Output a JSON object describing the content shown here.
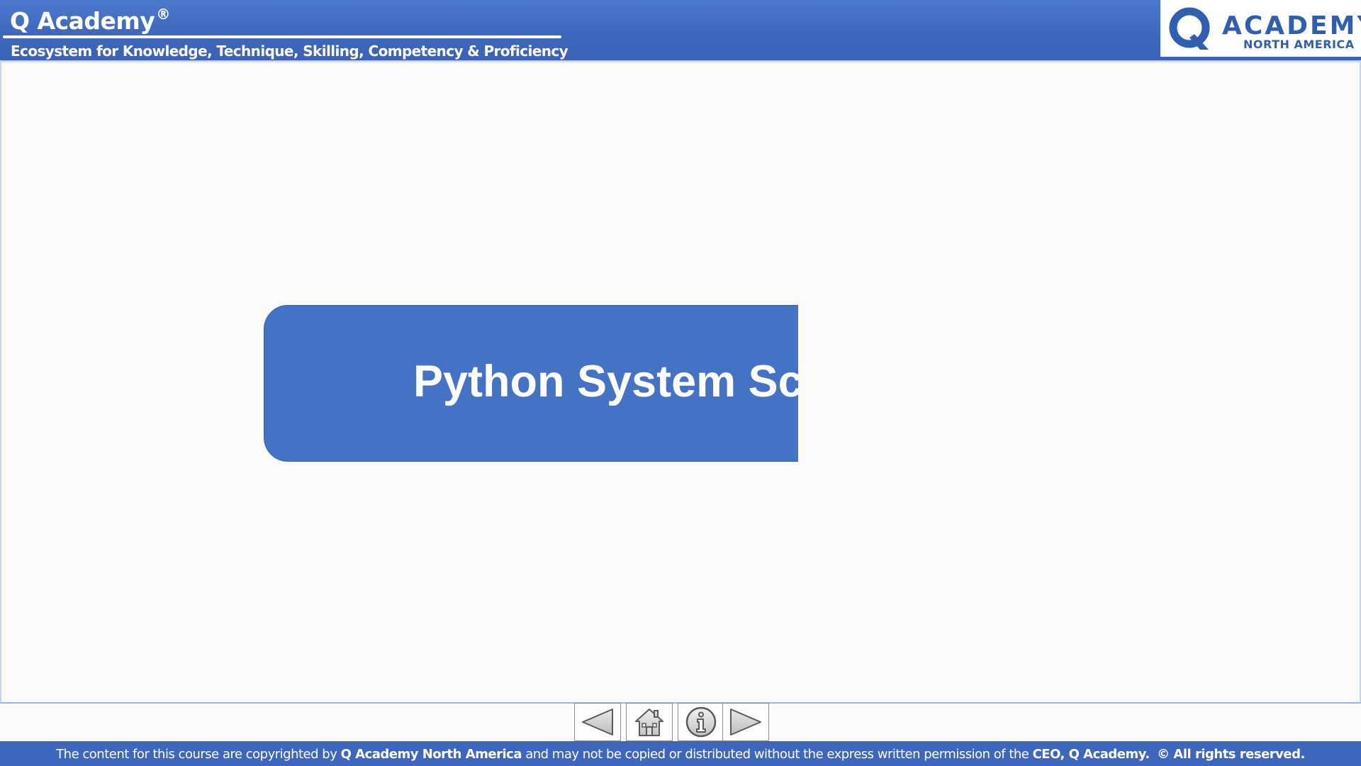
{
  "header": {
    "brand_title": "Q Academy",
    "registered_mark": "®",
    "tagline": "Ecosystem for Knowledge, Technique, Skilling, Competency & Proficiency",
    "logo": {
      "word": "ACADEMY",
      "sub": "NORTH AMERICA",
      "icon": "q-logo-icon",
      "color": "#2f5fb3"
    },
    "color": "#3f68bd"
  },
  "slide": {
    "banner_text": "Python System Sc",
    "banner_color": "#4472c4"
  },
  "nav": {
    "buttons": [
      {
        "icon": "triangle-left-icon",
        "action": "previous"
      },
      {
        "icon": "home-icon",
        "action": "home"
      },
      {
        "icon": "info-icon",
        "action": "info"
      },
      {
        "icon": "triangle-right-icon",
        "action": "next"
      }
    ]
  },
  "footer": {
    "part1": "The content for this course are copyrighted by ",
    "owner": "Q Academy North America",
    "part2": " and may not be copied or distributed without the express written permission of the ",
    "ceo": "CEO, Q Academy.",
    "rights": "© All rights reserved.",
    "color": "#3d66bc"
  }
}
